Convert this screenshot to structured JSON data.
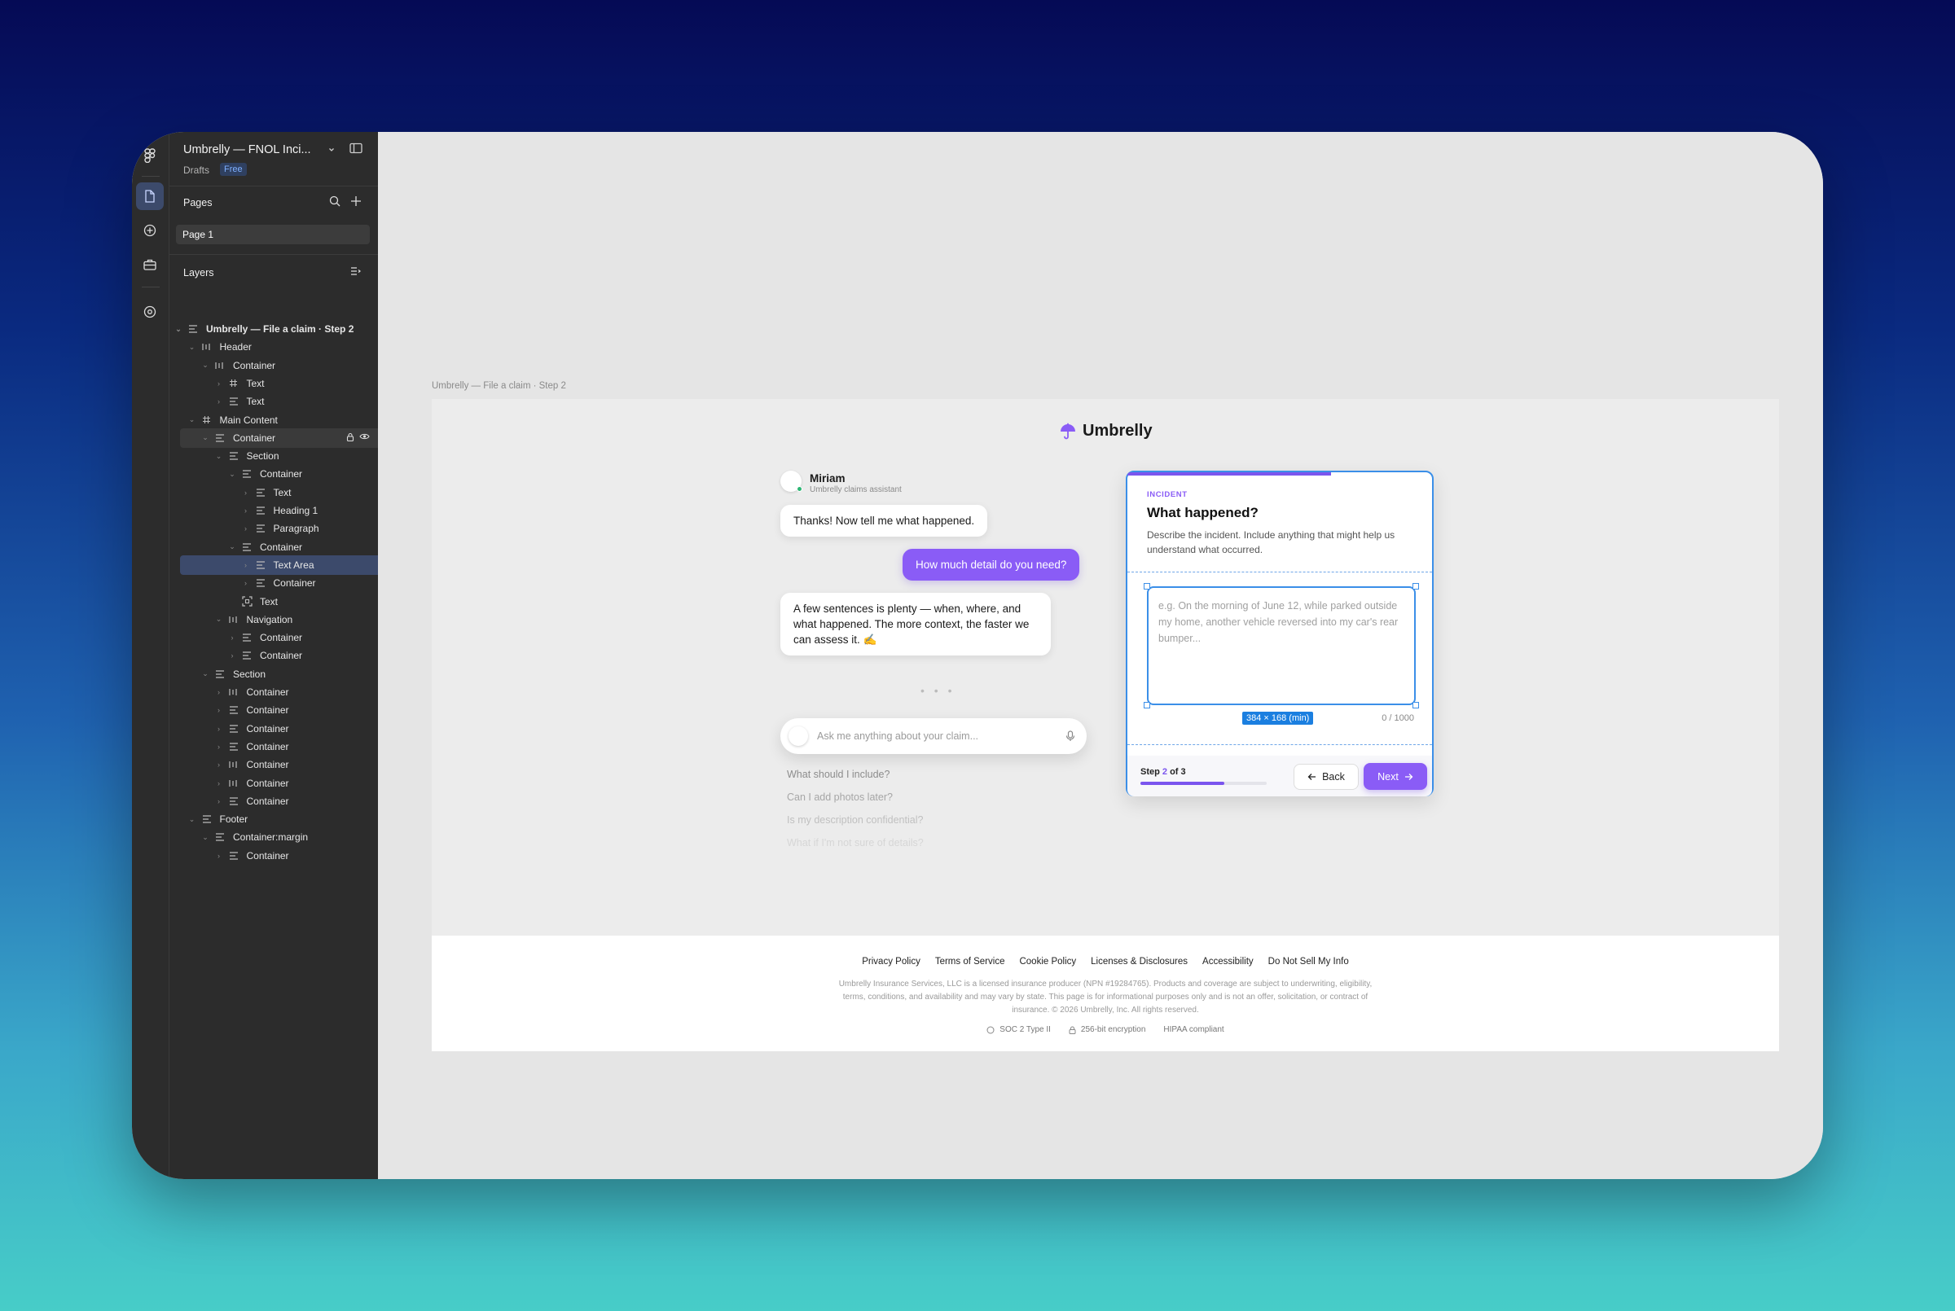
{
  "file": {
    "title": "Umbrelly — FNOL Inci...",
    "location": "Drafts",
    "plan": "Free"
  },
  "pages": {
    "heading": "Pages",
    "items": [
      "Page 1"
    ]
  },
  "layers": {
    "heading": "Layers",
    "items": [
      {
        "label": "Umbrelly — File a claim · Step 2"
      },
      {
        "label": "Header"
      },
      {
        "label": "Container"
      },
      {
        "label": "Text"
      },
      {
        "label": "Text"
      },
      {
        "label": "Main Content"
      },
      {
        "label": "Container"
      },
      {
        "label": "Section"
      },
      {
        "label": "Container"
      },
      {
        "label": "Text"
      },
      {
        "label": "Heading 1"
      },
      {
        "label": "Paragraph"
      },
      {
        "label": "Container"
      },
      {
        "label": "Text Area"
      },
      {
        "label": "Container"
      },
      {
        "label": "Text"
      },
      {
        "label": "Navigation"
      },
      {
        "label": "Container"
      },
      {
        "label": "Container"
      },
      {
        "label": "Section"
      },
      {
        "label": "Container"
      },
      {
        "label": "Container"
      },
      {
        "label": "Container"
      },
      {
        "label": "Container"
      },
      {
        "label": "Container"
      },
      {
        "label": "Container"
      },
      {
        "label": "Container"
      },
      {
        "label": "Footer"
      },
      {
        "label": "Container:margin"
      },
      {
        "label": "Container"
      }
    ]
  },
  "frame": {
    "label": "Umbrelly — File a claim · Step 2"
  },
  "brand": {
    "name": "Umbrelly",
    "accent": "#8a5cf6"
  },
  "assistant": {
    "name": "Miriam",
    "role": "Umbrelly claims assistant"
  },
  "messages": [
    {
      "from": "assistant",
      "text": "Thanks! Now tell me what happened."
    },
    {
      "from": "user",
      "text": "How much detail do you need?"
    },
    {
      "from": "assistant",
      "text": "A few sentences is plenty — when, where, and what happened. The more context, the faster we can assess it. ✍️"
    }
  ],
  "typing": "• • •",
  "ask": {
    "placeholder": "Ask me anything about your claim..."
  },
  "suggestions": [
    "What should I include?",
    "Can I add photos later?",
    "Is my description confidential?",
    "What if I'm not sure of details?"
  ],
  "card": {
    "eyebrow": "INCIDENT",
    "title": "What happened?",
    "description": "Describe the incident. Include anything that might help us understand what occurred.",
    "textarea_placeholder": "e.g. On the morning of June 12, while parked outside my home, another vehicle reversed into my car's rear bumper...",
    "dimension_tag": "384 × 168 (min)",
    "char_count": "0 / 1000",
    "step_prefix": "Step ",
    "step_current": "2",
    "step_suffix": " of 3",
    "step_progress": 0.667,
    "back_label": "Back",
    "next_label": "Next"
  },
  "footer": {
    "links": [
      "Privacy Policy",
      "Terms of Service",
      "Cookie Policy",
      "Licenses & Disclosures",
      "Accessibility",
      "Do Not Sell My Info"
    ],
    "legal": "Umbrelly Insurance Services, LLC is a licensed insurance producer (NPN #19284765). Products and coverage are subject to underwriting, eligibility, terms, conditions, and availability and may vary by state. This page is for informational purposes only and is not an offer, solicitation, or contract of insurance. © 2026 Umbrelly, Inc. All rights reserved.",
    "badges": [
      "SOC 2 Type II",
      "256-bit encryption",
      "HIPAA compliant"
    ]
  }
}
